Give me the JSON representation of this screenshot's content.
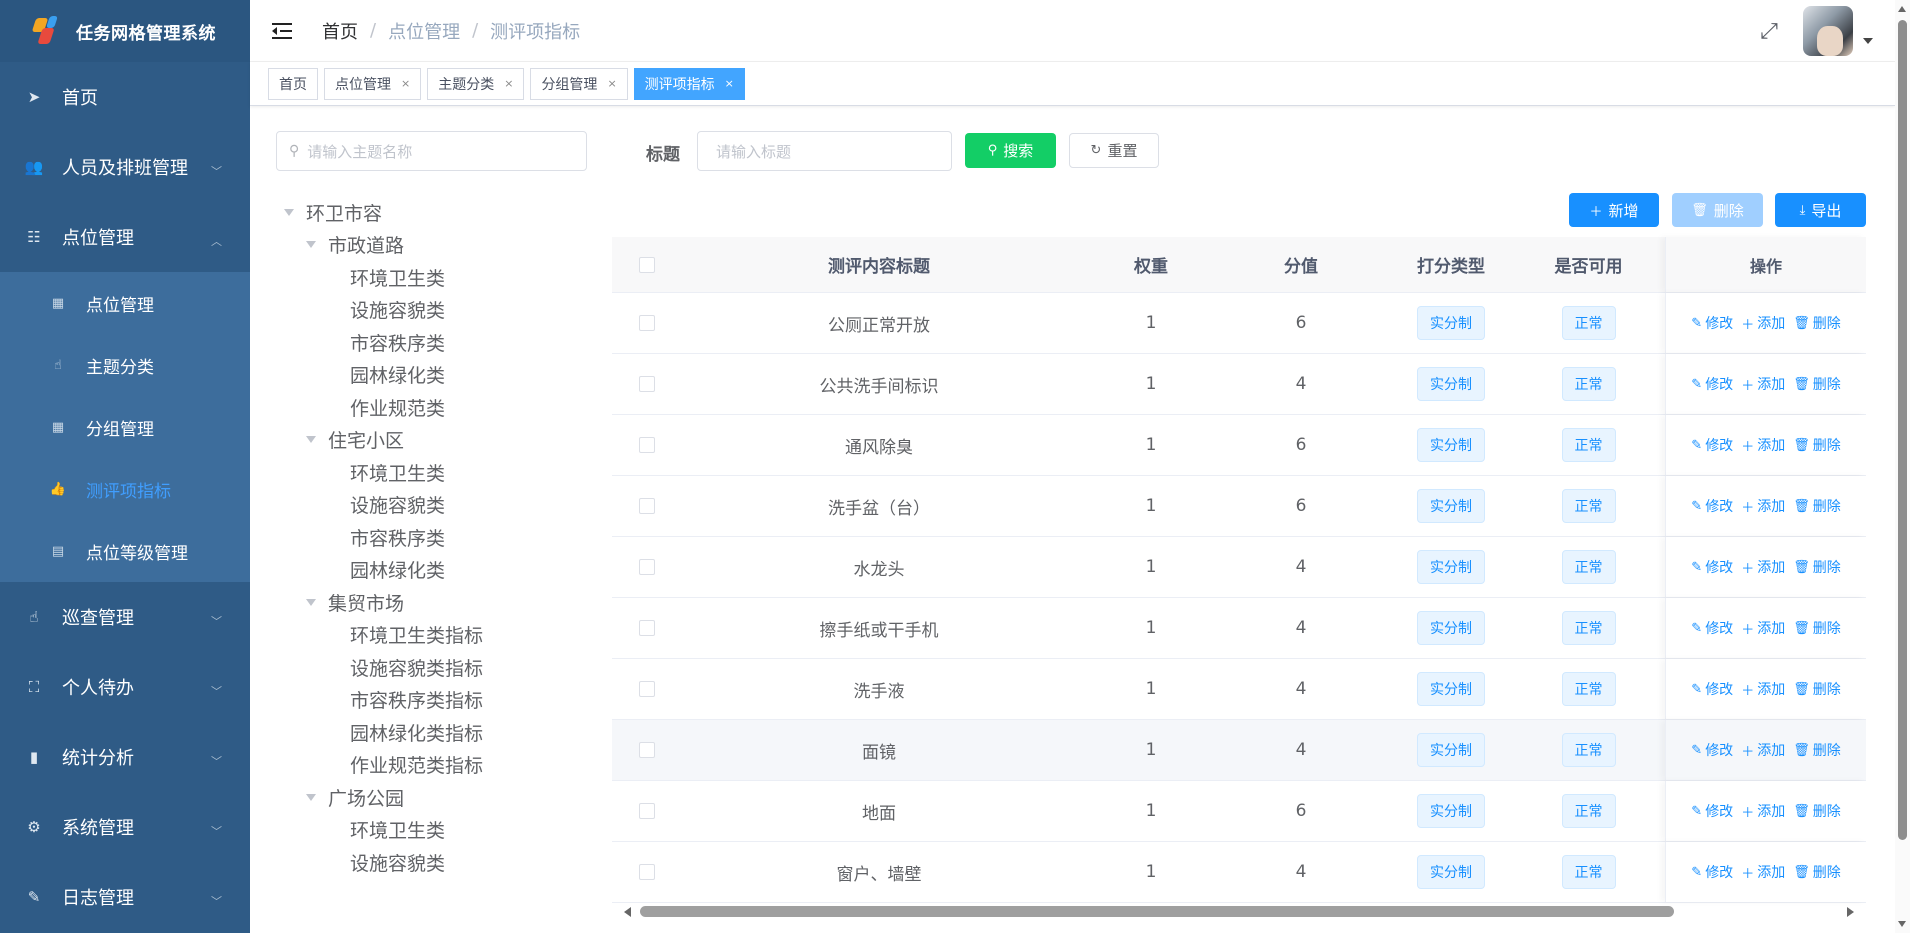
{
  "app": {
    "title": "任务网格管理系统"
  },
  "sidebar": {
    "items": [
      {
        "label": "首页",
        "icon": "send-icon"
      },
      {
        "label": "人员及排班管理",
        "icon": "users-icon"
      },
      {
        "label": "点位管理",
        "icon": "list-icon",
        "expanded": true
      },
      {
        "label": "巡查管理",
        "icon": "hand-icon"
      },
      {
        "label": "个人待办",
        "icon": "flow-icon"
      },
      {
        "label": "统计分析",
        "icon": "bar-chart-icon"
      },
      {
        "label": "系统管理",
        "icon": "gear-icon"
      },
      {
        "label": "日志管理",
        "icon": "edit-doc-icon"
      }
    ],
    "sub_items": [
      {
        "label": "点位管理",
        "icon": "calendar-icon"
      },
      {
        "label": "主题分类",
        "icon": "hand-icon"
      },
      {
        "label": "分组管理",
        "icon": "calendar-icon"
      },
      {
        "label": "测评项指标",
        "icon": "thumb-icon",
        "active": true
      },
      {
        "label": "点位等级管理",
        "icon": "document-icon"
      }
    ]
  },
  "header": {
    "breadcrumb": [
      "首页",
      "点位管理",
      "测评项指标"
    ],
    "separator": "/"
  },
  "tags": [
    {
      "label": "首页"
    },
    {
      "label": "点位管理",
      "close": "×"
    },
    {
      "label": "主题分类",
      "close": "×"
    },
    {
      "label": "分组管理",
      "close": "×"
    },
    {
      "label": "测评项指标",
      "close": "×",
      "active": true
    }
  ],
  "tree": {
    "search_placeholder": "请输入主题名称",
    "nodes": [
      {
        "label": "环卫市容",
        "level": 0
      },
      {
        "label": "市政道路",
        "level": 1
      },
      {
        "label": "环境卫生类",
        "level": 2
      },
      {
        "label": "设施容貌类",
        "level": 2
      },
      {
        "label": "市容秩序类",
        "level": 2
      },
      {
        "label": "园林绿化类",
        "level": 2
      },
      {
        "label": "作业规范类",
        "level": 2
      },
      {
        "label": "住宅小区",
        "level": 1
      },
      {
        "label": "环境卫生类",
        "level": 2
      },
      {
        "label": "设施容貌类",
        "level": 2
      },
      {
        "label": "市容秩序类",
        "level": 2
      },
      {
        "label": "园林绿化类",
        "level": 2
      },
      {
        "label": "集贸市场",
        "level": 1
      },
      {
        "label": "环境卫生类指标",
        "level": 2
      },
      {
        "label": "设施容貌类指标",
        "level": 2
      },
      {
        "label": "市容秩序类指标",
        "level": 2
      },
      {
        "label": "园林绿化类指标",
        "level": 2
      },
      {
        "label": "作业规范类指标",
        "level": 2
      },
      {
        "label": "广场公园",
        "level": 1
      },
      {
        "label": "环境卫生类",
        "level": 2
      },
      {
        "label": "设施容貌类",
        "level": 2
      }
    ]
  },
  "filter": {
    "title_label": "标题",
    "title_placeholder": "请输入标题",
    "search_label": "搜索",
    "reset_label": "重置"
  },
  "toolbar": {
    "add_label": "新增",
    "delete_label": "删除",
    "export_label": "导出"
  },
  "table": {
    "columns": [
      "测评内容标题",
      "权重",
      "分值",
      "打分类型",
      "是否可用",
      "操作"
    ],
    "ops": {
      "edit": "修改",
      "add": "添加",
      "delete": "删除"
    },
    "rows": [
      {
        "title": "公厕正常开放",
        "weight": "1",
        "score": "6",
        "type": "实分制",
        "status": "正常"
      },
      {
        "title": "公共洗手间标识",
        "weight": "1",
        "score": "4",
        "type": "实分制",
        "status": "正常"
      },
      {
        "title": "通风除臭",
        "weight": "1",
        "score": "6",
        "type": "实分制",
        "status": "正常"
      },
      {
        "title": "洗手盆（台）",
        "weight": "1",
        "score": "6",
        "type": "实分制",
        "status": "正常"
      },
      {
        "title": "水龙头",
        "weight": "1",
        "score": "4",
        "type": "实分制",
        "status": "正常"
      },
      {
        "title": "擦手纸或干手机",
        "weight": "1",
        "score": "4",
        "type": "实分制",
        "status": "正常"
      },
      {
        "title": "洗手液",
        "weight": "1",
        "score": "4",
        "type": "实分制",
        "status": "正常"
      },
      {
        "title": "面镜",
        "weight": "1",
        "score": "4",
        "type": "实分制",
        "status": "正常",
        "hover": true
      },
      {
        "title": "地面",
        "weight": "1",
        "score": "6",
        "type": "实分制",
        "status": "正常"
      },
      {
        "title": "窗户、墙壁",
        "weight": "1",
        "score": "4",
        "type": "实分制",
        "status": "正常"
      }
    ]
  },
  "colors": {
    "sidebar": "#2f5b86",
    "submenu": "#3d6d9c",
    "primary": "#1890ff",
    "success": "#13ce66",
    "active_tag": "#42a5ff"
  }
}
